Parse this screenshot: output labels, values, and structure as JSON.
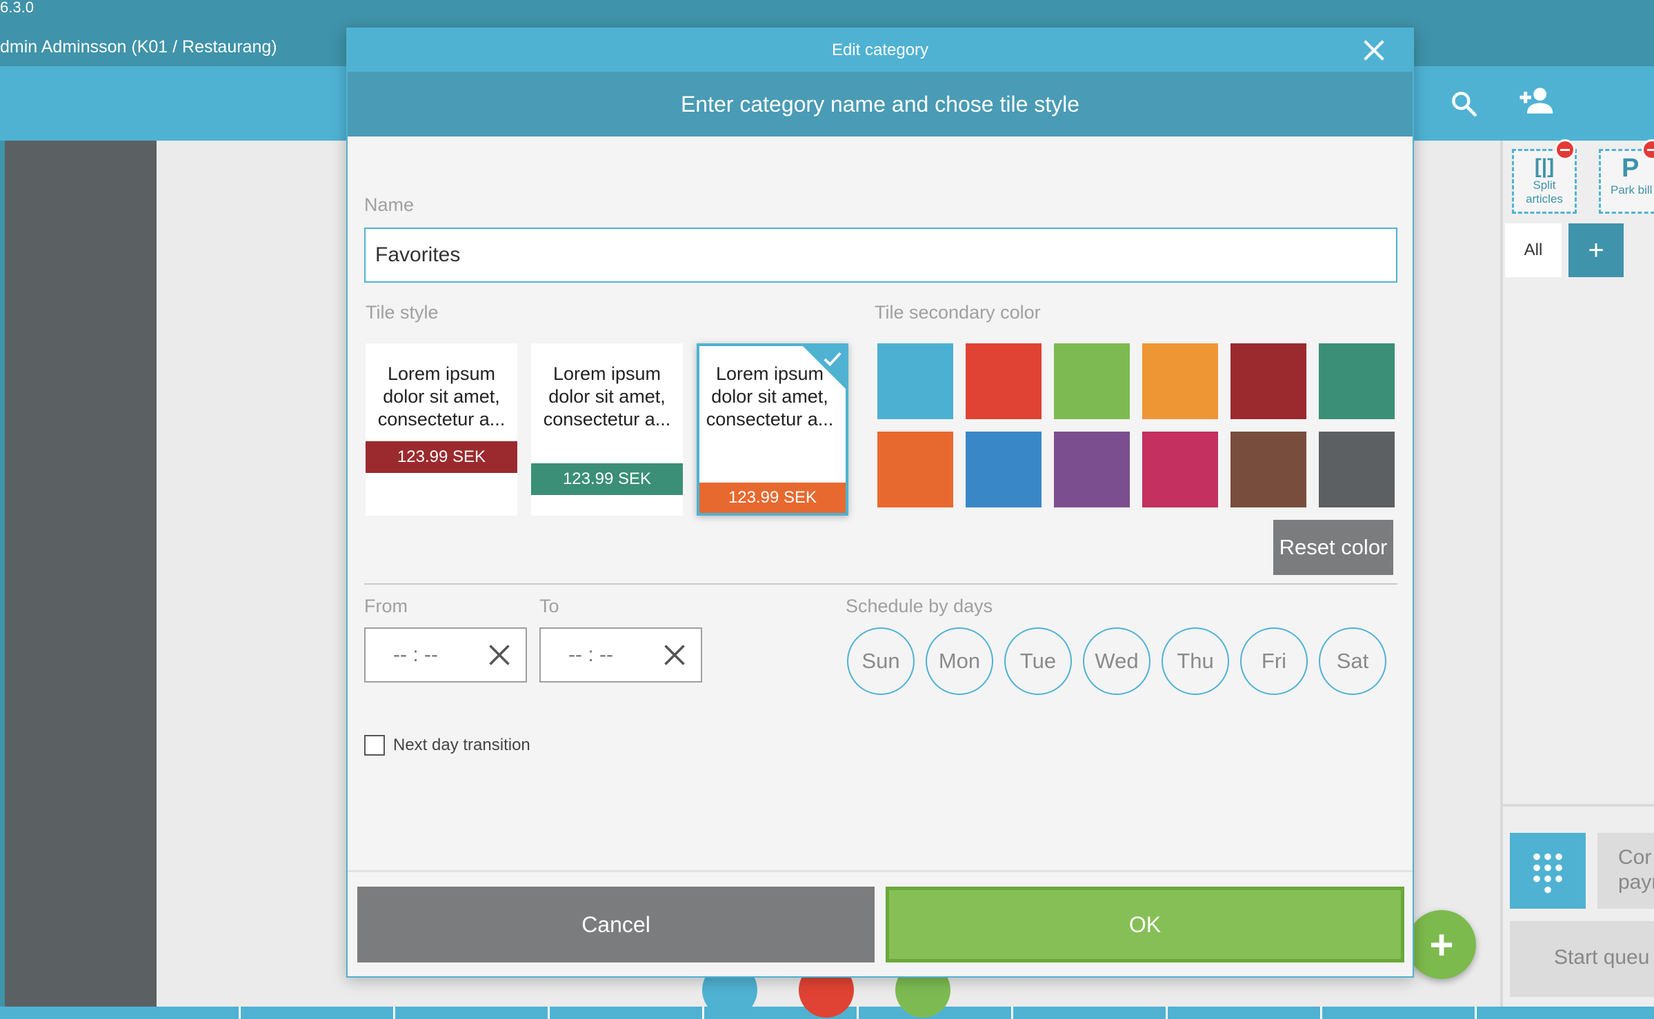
{
  "app": {
    "version": "6.3.0",
    "user_line": "dmin Adminsson (K01 / Restaurang)"
  },
  "right_panel": {
    "quick_buttons": [
      {
        "label_line1": "Split",
        "label_line2": "articles",
        "icon": "split-articles-icon"
      },
      {
        "label": "Park bill",
        "icon": "park-bill-icon"
      }
    ],
    "tabs": [
      {
        "label": "All"
      },
      {
        "label": "+"
      }
    ],
    "complete_payment_label_line1": "Cor",
    "complete_payment_label_line2": "paym",
    "start_queue_label": "Start queu",
    "fab_label": "+"
  },
  "modal": {
    "title": "Edit category",
    "subtitle": "Enter category name and chose tile style",
    "name_label": "Name",
    "name_value": "Favorites",
    "tile_style_label": "Tile style",
    "tiles": [
      {
        "text_line1": "Lorem ipsum",
        "text_line2": "dolor sit amet,",
        "text_line3": "consectetur a...",
        "price": "123.99 SEK",
        "selected": false
      },
      {
        "text_line1": "Lorem ipsum",
        "text_line2": "dolor sit amet,",
        "text_line3": "consectetur a...",
        "price": "123.99 SEK",
        "selected": false
      },
      {
        "text_line1": "Lorem ipsum",
        "text_line2": "dolor sit amet,",
        "text_line3": "consectetur a...",
        "price": "123.99 SEK",
        "selected": true
      }
    ],
    "secondary_color_label": "Tile secondary color",
    "swatches": [
      "#4bb0d2",
      "#e04333",
      "#7dbb52",
      "#ef9634",
      "#9b2a2e",
      "#3b8f77",
      "#e8692f",
      "#3a87c7",
      "#7b4e8f",
      "#c4305f",
      "#784d3e",
      "#5c6063"
    ],
    "reset_color_label": "Reset color",
    "from_label": "From",
    "to_label": "To",
    "from_value": "-- : --",
    "to_value": "-- : --",
    "schedule_label": "Schedule by days",
    "days": [
      "Sun",
      "Mon",
      "Tue",
      "Wed",
      "Thu",
      "Fri",
      "Sat"
    ],
    "next_day_label": "Next day transition",
    "next_day_checked": false,
    "cancel_label": "Cancel",
    "ok_label": "OK"
  },
  "colors": {
    "accent": "#4fb2d3",
    "header_dark": "#4a9bb5",
    "ok_green": "#85bf55",
    "cancel_gray": "#7b7c7e"
  }
}
